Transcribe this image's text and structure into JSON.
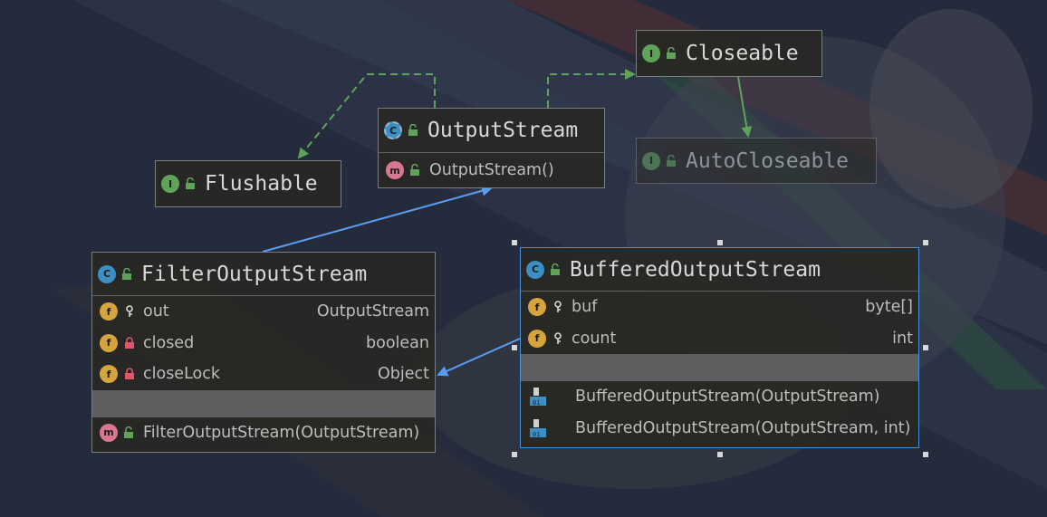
{
  "diagram": {
    "interfaces": [
      {
        "id": "closeable",
        "badge": "I",
        "name": "Closeable"
      },
      {
        "id": "autocloseable",
        "badge": "I",
        "name": "AutoCloseable"
      },
      {
        "id": "flushable",
        "badge": "I",
        "name": "Flushable"
      }
    ],
    "output_stream": {
      "badge": "C",
      "name": "OutputStream",
      "methods": [
        {
          "badge": "m",
          "label": "OutputStream()"
        }
      ]
    },
    "filter_output_stream": {
      "badge": "C",
      "name": "FilterOutputStream",
      "fields": [
        {
          "badge": "f",
          "name": "out",
          "type": "OutputStream",
          "access": "package"
        },
        {
          "badge": "f",
          "name": "closed",
          "type": "boolean",
          "access": "private"
        },
        {
          "badge": "f",
          "name": "closeLock",
          "type": "Object",
          "access": "private"
        }
      ],
      "methods": [
        {
          "badge": "m",
          "label": "FilterOutputStream(OutputStream)"
        }
      ]
    },
    "buffered_output_stream": {
      "badge": "C",
      "name": "BufferedOutputStream",
      "fields": [
        {
          "badge": "f",
          "name": "buf",
          "type": "byte[]",
          "access": "package"
        },
        {
          "badge": "f",
          "name": "count",
          "type": "int",
          "access": "package"
        }
      ],
      "constructors": [
        {
          "label": "BufferedOutputStream(OutputStream)"
        },
        {
          "label": "BufferedOutputStream(OutputStream, int)"
        }
      ]
    }
  },
  "colors": {
    "interface_badge": "#5fa35b",
    "class_badge": "#3c8fc4",
    "method_badge": "#d97690",
    "field_badge": "#d6a43c",
    "implements_edge": "#5fa35b",
    "extends_edge": "#5b9cf0",
    "selection": "#4a8fdb"
  },
  "icons": {
    "interface": "interface-icon",
    "class": "class-icon",
    "method": "method-icon",
    "field": "field-icon",
    "public": "unlocked-icon",
    "private": "padlock-icon",
    "package": "key-icon",
    "constructor": "constructor-icon"
  }
}
